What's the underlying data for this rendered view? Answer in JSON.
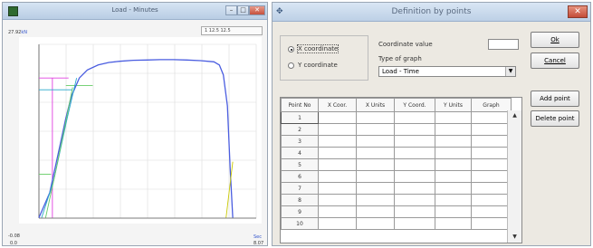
{
  "graph_window": {
    "title": "Load - Minutes",
    "controls": {
      "minimize": "–",
      "maximize": "□",
      "close": "✕"
    },
    "toolbar_text": "1   12.5   12.5",
    "y_axis": {
      "top": "27.92",
      "unit": "kN",
      "bottom": "-0.08"
    },
    "x_axis": {
      "left": "0.0",
      "unit": "Sec",
      "right": "8.07"
    },
    "chart_data": {
      "type": "line",
      "xlabel": "Sec",
      "ylabel": "kN",
      "xlim": [
        0.0,
        8.07
      ],
      "ylim": [
        -0.08,
        27.92
      ],
      "series": [
        {
          "color": "#4a5de0",
          "x": [
            0.0,
            0.4,
            0.8,
            1.0,
            1.2,
            1.5,
            1.8,
            2.2,
            2.6,
            3.0,
            3.5,
            4.0,
            4.5,
            5.0,
            5.5,
            6.0,
            6.5,
            6.7,
            6.85,
            7.0,
            7.1,
            7.2
          ],
          "y": [
            0.0,
            4.0,
            12.0,
            16.0,
            19.5,
            22.5,
            23.8,
            24.6,
            25.0,
            25.2,
            25.35,
            25.4,
            25.45,
            25.45,
            25.4,
            25.3,
            25.1,
            24.6,
            23.0,
            18.0,
            8.0,
            0.0
          ]
        },
        {
          "color": "#27a8c9",
          "x": [
            0.1,
            0.55,
            1.05,
            1.4
          ],
          "y": [
            0.0,
            6.0,
            16.0,
            22.5
          ]
        },
        {
          "color": "#66cc66",
          "x": [
            0.25,
            0.6,
            1.0,
            1.25
          ],
          "y": [
            0.0,
            7.0,
            15.5,
            21.0
          ]
        },
        {
          "color": "#c8c800",
          "x": [
            6.95,
            7.2
          ],
          "y": [
            0.0,
            9.0
          ]
        }
      ],
      "markers": [
        {
          "color": "#e040e0",
          "orientation": "horizontal",
          "y": 22.5,
          "x_from": 0.0,
          "x_to": 1.1
        },
        {
          "color": "#e040e0",
          "orientation": "vertical",
          "x": 0.5,
          "y_from": 0.0,
          "y_to": 22.5
        },
        {
          "color": "#66cc66",
          "orientation": "horizontal",
          "y": 21.3,
          "x_from": 1.0,
          "x_to": 2.0
        },
        {
          "color": "#66cc66",
          "orientation": "horizontal",
          "y": 7.0,
          "x_from": 0.0,
          "x_to": 0.45
        },
        {
          "color": "#27a8c9",
          "orientation": "horizontal",
          "y": 20.6,
          "x_from": 0.0,
          "x_to": 1.25
        }
      ]
    }
  },
  "dialog": {
    "title": "Definition by points",
    "close": "✕",
    "radio_x": "X coordinate",
    "radio_y": "Y coordinate",
    "coord_value_label": "Coordinate value",
    "coord_value": "",
    "graph_type_label": "Type of graph",
    "graph_type_value": "Load - Time",
    "ok_label": "Ok",
    "cancel_label": "Cancel",
    "add_point_label": "Add point",
    "delete_point_label": "Delete point",
    "columns": [
      "Point No",
      "X Coor.",
      "X Units",
      "Y Coord.",
      "Y Units",
      "Graph"
    ],
    "rows": [
      "1",
      "2",
      "3",
      "4",
      "5",
      "6",
      "7",
      "8",
      "9",
      "10"
    ]
  }
}
